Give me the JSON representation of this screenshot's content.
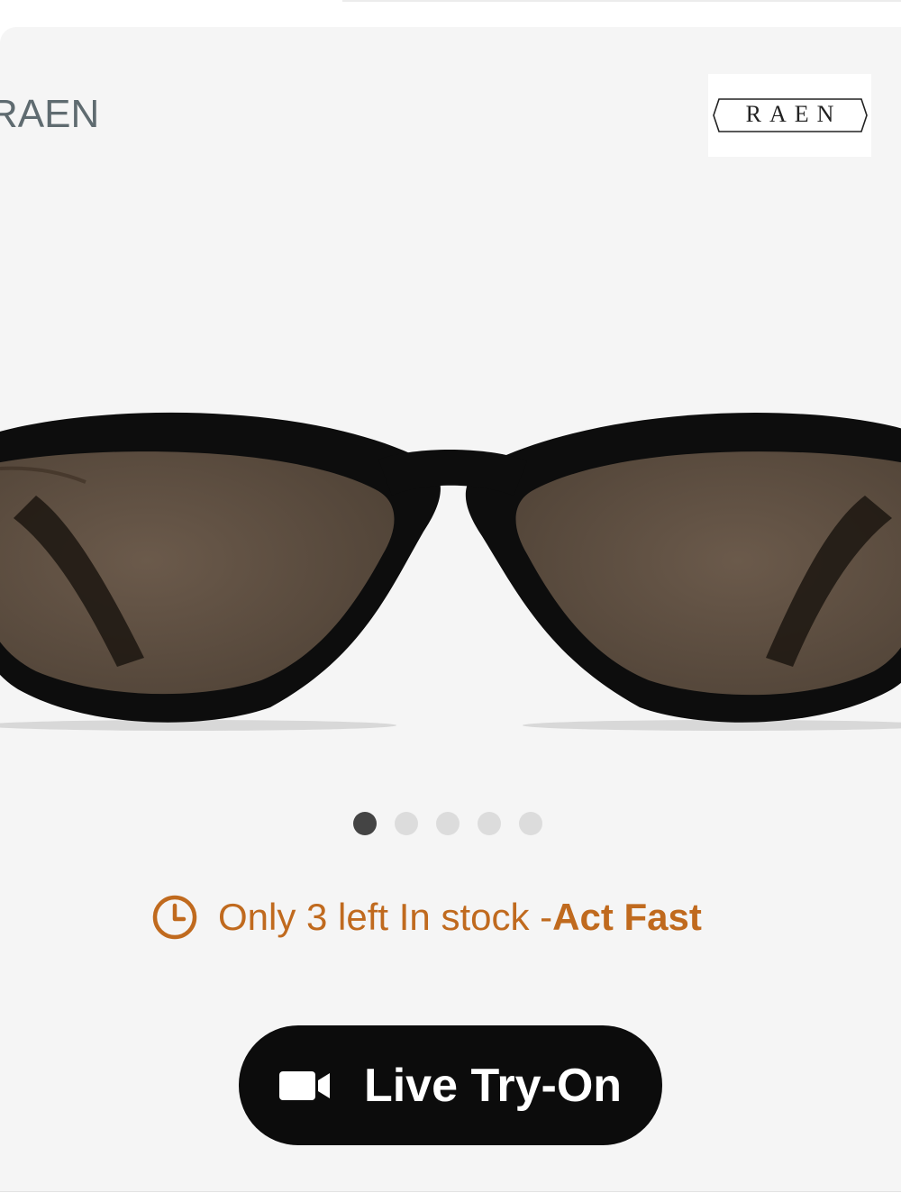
{
  "brand": {
    "name": "RAEN",
    "logo_text": "RAEN",
    "logo_icon": "raen-logo"
  },
  "gallery": {
    "image_icon": "sunglasses-product-image",
    "total_slides": 5,
    "active_slide": 1
  },
  "stock": {
    "icon": "clock-icon",
    "message": "Only 3 left In stock - ",
    "urgency": "Act Fast",
    "color": "#c06a1e"
  },
  "try_on": {
    "icon": "video-camera-icon",
    "label": "Live Try-On"
  }
}
